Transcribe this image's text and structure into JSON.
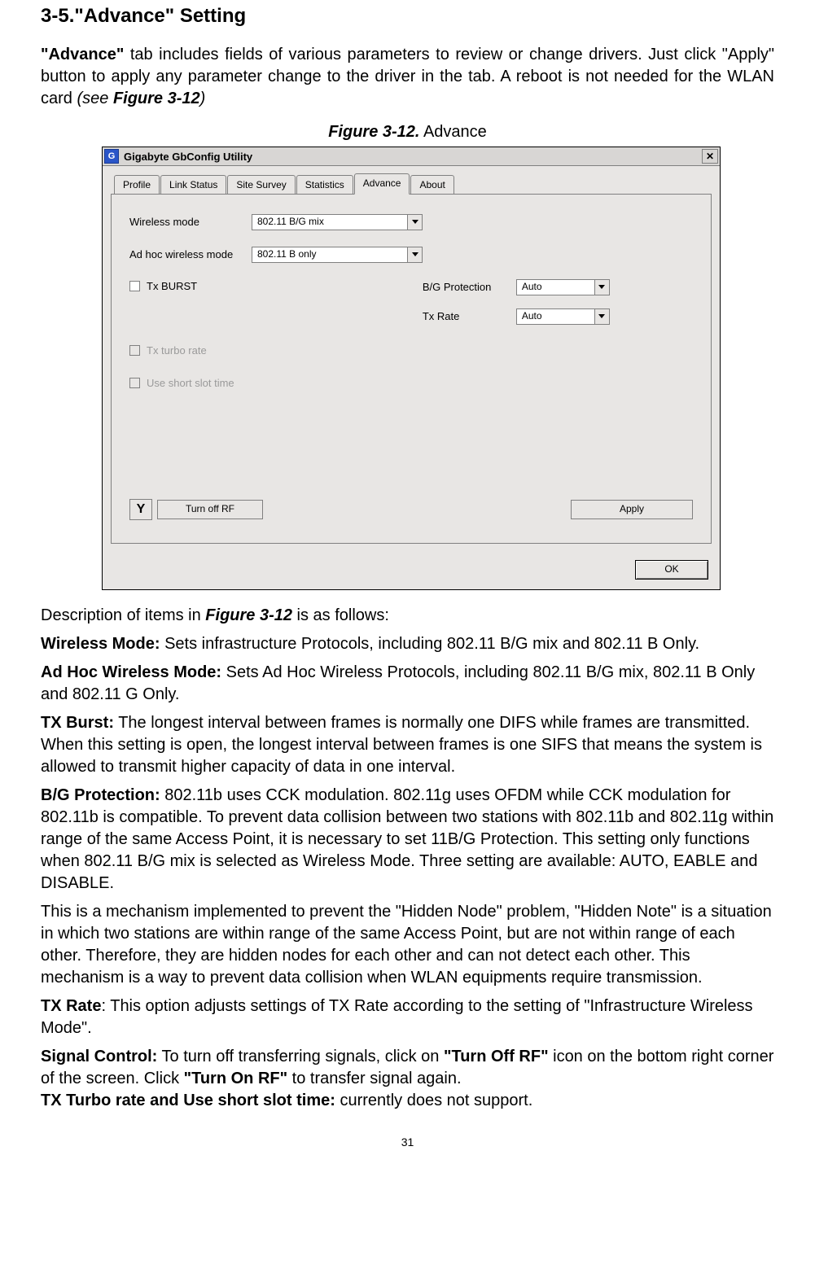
{
  "section_title": "3-5.\"Advance\" Setting",
  "intro_html": "<b>\"Advance\"</b> tab includes fields of various parameters to review or change drivers. Just click \"Apply\" button to apply any parameter change to the driver in the tab. A reboot is not needed for the WLAN card <i>(see <b>Figure 3-12</b>)</i>",
  "figure_caption_bold": "Figure 3-12.",
  "figure_caption_rest": "  Advance",
  "app": {
    "title": "Gigabyte GbConfig Utility",
    "close_glyph": "✕",
    "tabs": [
      "Profile",
      "Link Status",
      "Site Survey",
      "Statistics",
      "Advance",
      "About"
    ],
    "active_tab_index": 4,
    "wireless_mode_label": "Wireless mode",
    "wireless_mode_value": "802.11 B/G mix",
    "adhoc_label": "Ad hoc wireless mode",
    "adhoc_value": "802.11 B only",
    "tx_burst_label": "Tx BURST",
    "tx_turbo_label": "Tx turbo rate",
    "short_slot_label": "Use short slot time",
    "bg_protection_label": "B/G Protection",
    "bg_protection_value": "Auto",
    "tx_rate_label": "Tx Rate",
    "tx_rate_value": "Auto",
    "rf_icon_glyph": "Y",
    "turn_off_rf_label": "Turn off RF",
    "apply_label": "Apply",
    "ok_label": "OK"
  },
  "desc_intro_html": "Description of items in <b><i>Figure 3-12</i></b> is as follows:",
  "desc_wireless_html": "<b>Wireless Mode:</b> Sets infrastructure Protocols, including 802.11 B/G mix and 802.11 B Only.",
  "desc_adhoc_html": "<b>Ad Hoc Wireless Mode:</b> Sets Ad Hoc Wireless Protocols, including 802.11 B/G mix, 802.11 B Only and 802.11 G Only.",
  "desc_txburst_html": "<b>TX Burst:</b> The longest interval between frames is normally one DIFS while frames are transmitted. When this setting is open, the longest interval between frames is one SIFS that means the system is allowed to transmit higher capacity of data in one interval.",
  "desc_bgprot_html": "<b>B/G Protection:</b> 802.11b uses CCK modulation. 802.11g uses OFDM while CCK modulation for 802.11b is compatible. To prevent data collision between two stations with 802.11b and 802.11g within range of the same Access Point, it is necessary to set 11B/G Protection. This setting only functions when 802.11 B/G mix is selected as Wireless Mode. Three setting are available: AUTO, EABLE and DISABLE.",
  "desc_hidden_html": "This is a mechanism implemented to prevent the \"Hidden Node\" problem, \"Hidden Note\" is a situation in which two stations are within range of the same Access Point, but are not within range of each other. Therefore, they are hidden nodes for each other and can not detect each other. This mechanism is a way to prevent data collision when WLAN equipments require transmission.",
  "desc_txrate_html": "<b>TX Rate</b>: This option adjusts settings of TX Rate according to the setting of \"Infrastructure Wireless Mode\".",
  "desc_signal_html": "<b>Signal Control:</b> To turn off transferring signals, click on <b>\"Turn Off RF\"</b> icon on the bottom right corner of the screen. Click <b>\"Turn On RF\"</b> to transfer signal again.<br><b>TX Turbo rate and Use short slot time:</b> currently does not support.",
  "page_number": "31"
}
